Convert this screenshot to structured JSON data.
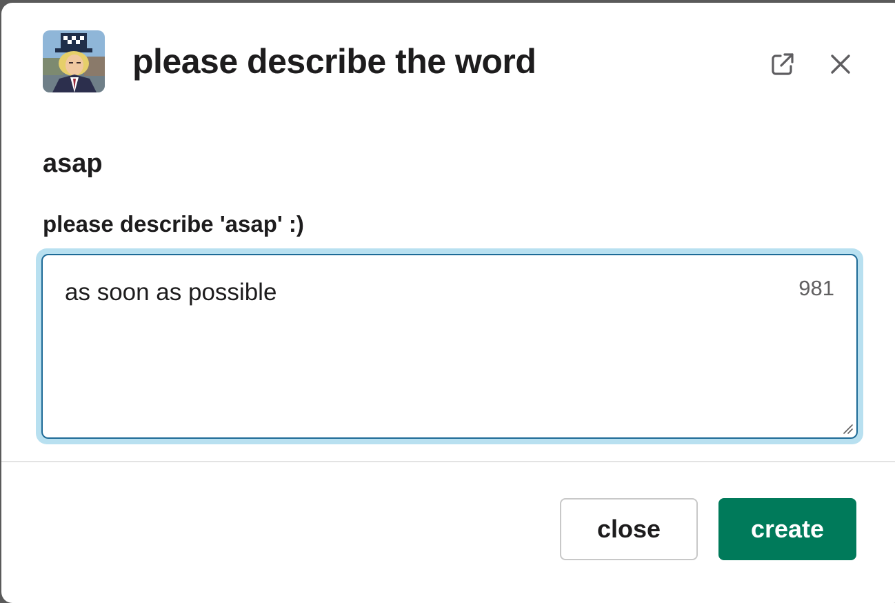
{
  "modal": {
    "title": "please describe the word",
    "avatar": "app-avatar"
  },
  "header_icons": {
    "popout": "external-link-icon",
    "close": "close-icon"
  },
  "section": {
    "title": "asap"
  },
  "field": {
    "label": "please describe 'asap' :)",
    "value": "as soon as possible",
    "remaining_chars": "981"
  },
  "footer": {
    "close_label": "close",
    "create_label": "create"
  },
  "colors": {
    "primary": "#007a5a",
    "focus_ring": "#b8e0f0",
    "focus_border": "#1d6a96",
    "text": "#1d1c1d"
  }
}
